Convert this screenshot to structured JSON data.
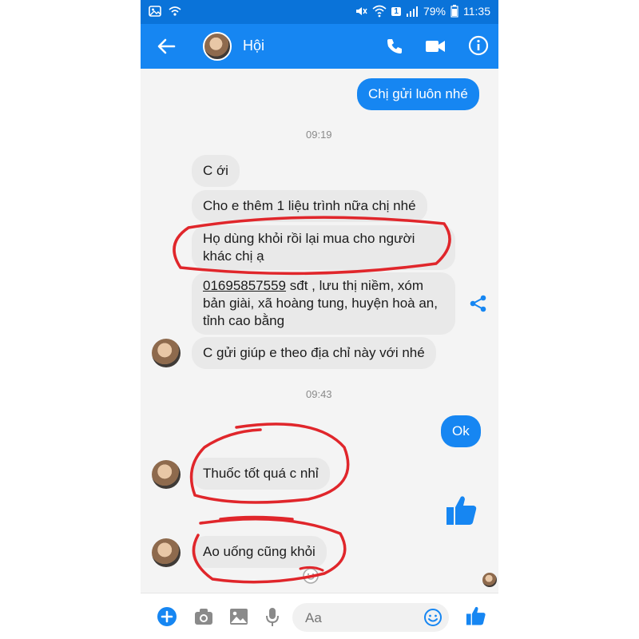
{
  "status_bar": {
    "battery": "79%",
    "time": "11:35",
    "sim": "1"
  },
  "header": {
    "contact_name": "Hội"
  },
  "conversation": {
    "sent_top": "Chị gửi luôn nhé",
    "timestamp_1": "09:19",
    "incoming_1": [
      "C ới",
      "Cho e thêm 1 liệu trình nữa chị nhé",
      {
        "line1": "Họ dùng khỏi rồi lại mua cho người",
        "line2": "khác chị ạ"
      },
      {
        "phone": "01695857559",
        "line1_rest": " sđt , lưu thị niềm, xóm",
        "line2": "bản giài, xã hoàng tung, huyện hoà an,",
        "line3": "tỉnh cao bằng"
      },
      "C gửi giúp e theo địa chỉ này với nhé"
    ],
    "timestamp_2": "09:43",
    "sent_ok": "Ok",
    "incoming_2": "Thuốc tốt quá c nhỉ",
    "incoming_3": "Ao uống cũng khỏi"
  },
  "composer": {
    "placeholder": "Aa"
  },
  "colors": {
    "brand": "#1686f2",
    "status_bar": "#0a73d9",
    "incoming_bubble": "#e9e9e9",
    "annotation": "#e0262b"
  }
}
